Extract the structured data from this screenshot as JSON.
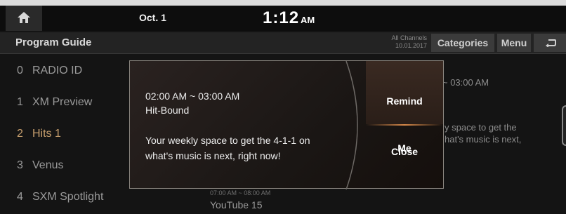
{
  "status": {
    "date": "Oct. 1",
    "time": "1:12",
    "ampm": "AM",
    "home_icon": "home-icon"
  },
  "header": {
    "title": "Program Guide",
    "channels_label": "All Channels",
    "channels_date": "10.01.2017",
    "categories_label": "Categories",
    "menu_label": "Menu",
    "back_icon": "back-arrow-icon"
  },
  "channels": [
    {
      "number": "0",
      "name": "RADIO ID"
    },
    {
      "number": "1",
      "name": "XM Preview"
    },
    {
      "number": "2",
      "name": "Hits 1"
    },
    {
      "number": "3",
      "name": "Venus"
    },
    {
      "number": "4",
      "name": "SXM Spotlight"
    }
  ],
  "active_channel_color": "#c8a06e",
  "background": {
    "time_right": "~ 03:00 AM",
    "desc_right_line1": "y space to get the",
    "desc_right_line2": "hat's music is next,",
    "time_bottom": "07:00 AM ~ 08:00 AM",
    "title_bottom": "YouTube 15"
  },
  "popup": {
    "time": "02:00 AM ~ 03:00 AM",
    "show": "Hit-Bound",
    "description_line1": "Your weekly space to get the 4-1-1 on",
    "description_line2": "what's music is next, right now!",
    "remind_line1": "Remind",
    "remind_line2": "Me",
    "close_label": "Close"
  }
}
